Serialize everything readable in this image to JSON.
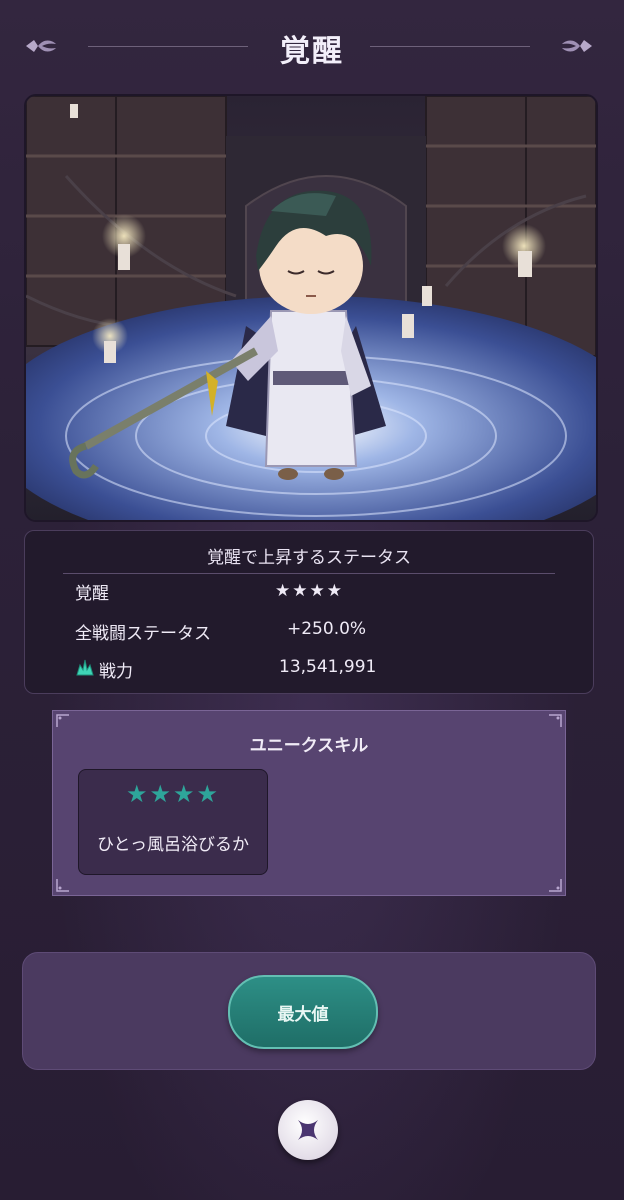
{
  "header": {
    "title": "覚醒"
  },
  "status": {
    "title": "覚醒で上昇するステータス",
    "rows": [
      {
        "label": "覚醒",
        "value": "★★★★"
      },
      {
        "label": "全戦闘ステータス",
        "value": "+250.0%"
      },
      {
        "label": "戦力",
        "value": "13,541,991",
        "icon": "power-flame-icon"
      }
    ]
  },
  "skill": {
    "title": "ユニークスキル",
    "card": {
      "stars": "★★★★",
      "name": "ひとっ風呂浴びるか"
    }
  },
  "buttons": {
    "max_label": "最大値",
    "close_icon": "close-x-icon"
  },
  "colors": {
    "accent_teal": "#2ea59a",
    "panel_purple": "#574470",
    "background": "#2b2038"
  }
}
